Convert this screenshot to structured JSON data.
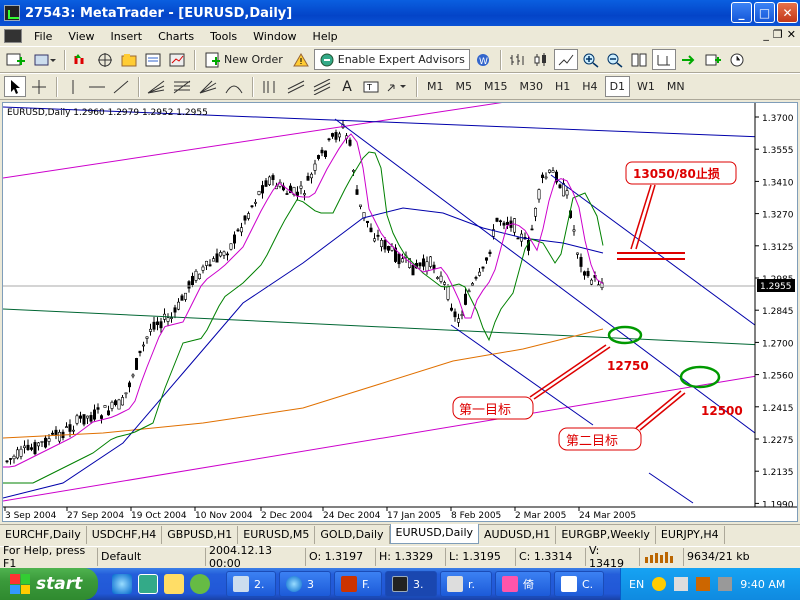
{
  "window": {
    "title": "27543: MetaTrader - [EURUSD,Daily]"
  },
  "menu": {
    "items": [
      "File",
      "View",
      "Insert",
      "Charts",
      "Tools",
      "Window",
      "Help"
    ]
  },
  "toolbar": {
    "new_order": "New Order",
    "expert_advisors": "Enable Expert Advisors",
    "timeframes": [
      "M1",
      "M5",
      "M15",
      "M30",
      "H1",
      "H4",
      "D1",
      "W1",
      "MN"
    ],
    "active_timeframe": "D1"
  },
  "chart": {
    "header": "EURUSD,Daily  1.2960 1.2979 1.2952 1.2955",
    "price_labels": [
      "1.3700",
      "1.3555",
      "1.3410",
      "1.3270",
      "1.3125",
      "1.2985",
      "1.2845",
      "1.2700",
      "1.2560",
      "1.2415",
      "1.2275",
      "1.2135",
      "1.1990"
    ],
    "current_price": "1.2955",
    "date_labels": [
      "3 Sep 2004",
      "27 Sep 2004",
      "19 Oct 2004",
      "10 Nov 2004",
      "2 Dec 2004",
      "24 Dec 2004",
      "17 Jan 2005",
      "8 Feb 2005",
      "2 Mar 2005",
      "24 Mar 2005"
    ],
    "annotations": {
      "stop_loss": "13050/80止损",
      "target1_value": "12750",
      "target1_label": "第一目标",
      "target2_value": "12500",
      "target2_label": "第二目标"
    },
    "colors": {
      "candle": "#000000",
      "ma_fast": "#cc00cc",
      "ma_mid": "#008000",
      "ma_slow": "#0000aa",
      "ma_long": "#e07000",
      "channel": "#0000aa",
      "annotation": "#dd0000",
      "target_circle": "#009900"
    }
  },
  "tabs": {
    "items": [
      "EURCHF,Daily",
      "USDCHF,H4",
      "GBPUSD,H1",
      "EURUSD,M5",
      "GOLD,Daily",
      "EURUSD,Daily",
      "AUDUSD,H1",
      "EURGBP,Weekly",
      "EURJPY,H4"
    ],
    "active": "EURUSD,Daily"
  },
  "status": {
    "help": "For Help, press F1",
    "profile": "Default",
    "time": "2004.12.13 00:00",
    "open": "O: 1.3197",
    "high": "H: 1.3329",
    "low": "L: 1.3195",
    "close": "C: 1.3314",
    "volume": "V: 13419",
    "traffic": "9634/21 kb"
  },
  "taskbar": {
    "start": "start",
    "tasks": [
      "2.",
      "3",
      "F.",
      "3.",
      "r.",
      "倚",
      "C."
    ],
    "lang": "EN",
    "clock": "9:40 AM"
  }
}
